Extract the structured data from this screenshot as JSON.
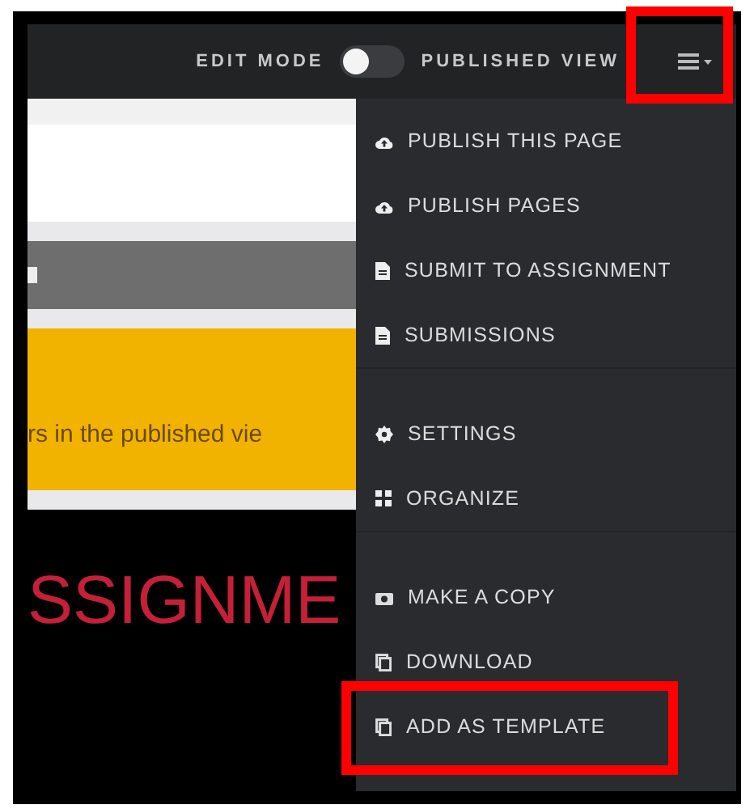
{
  "top_bar": {
    "left_label": "EDIT MODE",
    "toggle": {
      "on": false
    },
    "right_label": "PUBLISHED VIEW"
  },
  "page": {
    "notice": "rs in the published vie",
    "heading": "SSIGNME"
  },
  "menu": {
    "groups": [
      {
        "items": [
          "PUBLISH THIS PAGE",
          "PUBLISH PAGES",
          "SUBMIT TO ASSIGNMENT",
          "SUBMISSIONS"
        ]
      },
      {
        "items": [
          "SETTINGS",
          "ORGANIZE"
        ]
      },
      {
        "items": [
          "MAKE A COPY",
          "DOWNLOAD",
          "ADD AS TEMPLATE"
        ]
      }
    ]
  }
}
